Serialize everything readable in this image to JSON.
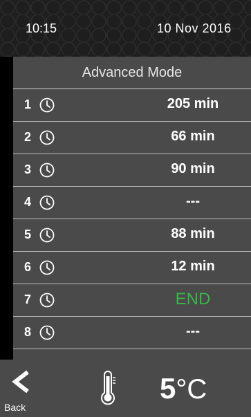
{
  "header": {
    "time": "10:15",
    "date": "10 Nov 2016"
  },
  "screen": {
    "title": "Advanced Mode"
  },
  "rows": [
    {
      "num": "1",
      "icon": "clock-icon",
      "value": "205 min"
    },
    {
      "num": "2",
      "icon": "clock-icon",
      "value": "66 min"
    },
    {
      "num": "3",
      "icon": "clock-icon",
      "value": "90 min"
    },
    {
      "num": "4",
      "icon": "clock-icon",
      "value": "---"
    },
    {
      "num": "5",
      "icon": "clock-icon",
      "value": "88 min"
    },
    {
      "num": "6",
      "icon": "clock-icon",
      "value": "12 min"
    },
    {
      "num": "7",
      "icon": "clock-icon",
      "value": "END"
    },
    {
      "num": "8",
      "icon": "clock-icon",
      "value": "---"
    }
  ],
  "footer": {
    "back_label": "Back",
    "temperature_value": "5",
    "temperature_unit": "°C"
  },
  "colors": {
    "end": "#3ab54a",
    "panel": "#4a4a4a",
    "header": "#1e1e1e"
  }
}
